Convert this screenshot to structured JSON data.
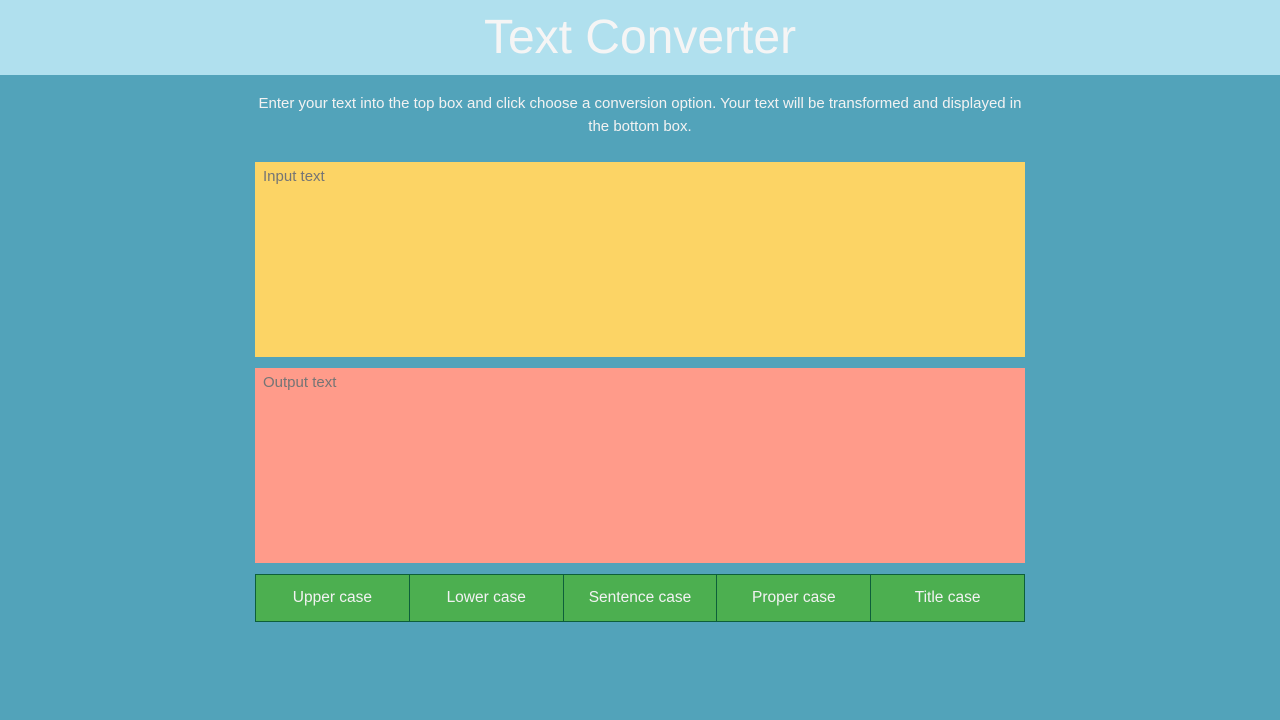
{
  "header": {
    "title": "Text Converter"
  },
  "instructions": "Enter your text into the top box and click choose a conversion option. Your text will be transformed and displayed in the bottom box.",
  "input": {
    "placeholder": "Input text",
    "value": ""
  },
  "output": {
    "placeholder": "Output text",
    "value": ""
  },
  "buttons": {
    "upper": "Upper case",
    "lower": "Lower case",
    "sentence": "Sentence case",
    "proper": "Proper case",
    "title": "Title case"
  }
}
